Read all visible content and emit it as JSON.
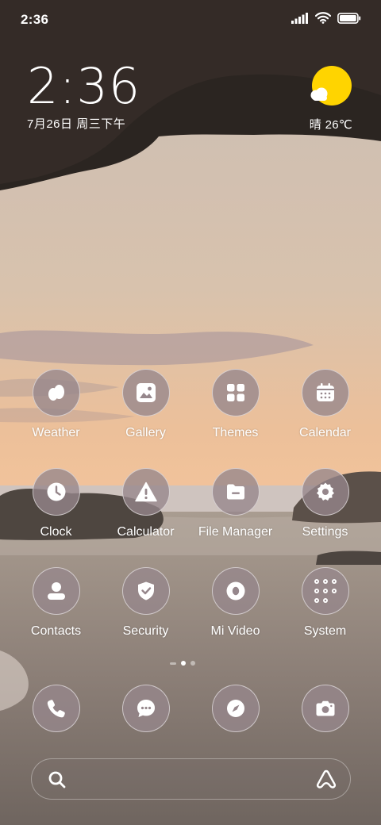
{
  "status_bar": {
    "time": "2:36",
    "icons": [
      "signal-icon",
      "wifi-icon",
      "battery-icon"
    ]
  },
  "clock_widget": {
    "time": "2:36",
    "date": "7月26日 周三下午"
  },
  "weather_widget": {
    "icon": "sunny-partly-cloudy-icon",
    "text": "晴 26℃",
    "sun_color": "#FFD400"
  },
  "apps": {
    "row1": [
      {
        "label": "Weather",
        "icon": "weather-drop-icon"
      },
      {
        "label": "Gallery",
        "icon": "gallery-icon"
      },
      {
        "label": "Themes",
        "icon": "themes-grid-icon"
      },
      {
        "label": "Calendar",
        "icon": "calendar-icon"
      }
    ],
    "row2": [
      {
        "label": "Clock",
        "icon": "clock-icon"
      },
      {
        "label": "Calculator",
        "icon": "calculator-icon"
      },
      {
        "label": "File Manager",
        "icon": "folder-icon"
      },
      {
        "label": "Settings",
        "icon": "gear-icon"
      }
    ],
    "row3": [
      {
        "label": "Contacts",
        "icon": "person-icon"
      },
      {
        "label": "Security",
        "icon": "shield-check-icon"
      },
      {
        "label": "Mi Video",
        "icon": "play-icon"
      },
      {
        "label": "System",
        "icon": "folder-grid-icon"
      }
    ]
  },
  "page_indicator": {
    "pages": 3,
    "active": 2
  },
  "dock": [
    {
      "icon": "phone-icon"
    },
    {
      "icon": "message-icon"
    },
    {
      "icon": "compass-icon"
    },
    {
      "icon": "camera-icon"
    }
  ],
  "search_bar": {
    "left_icon": "search-icon",
    "right_icon": "assistant-icon"
  },
  "colors": {
    "icon_bg": "#96878C",
    "text": "#FFFFFF"
  }
}
